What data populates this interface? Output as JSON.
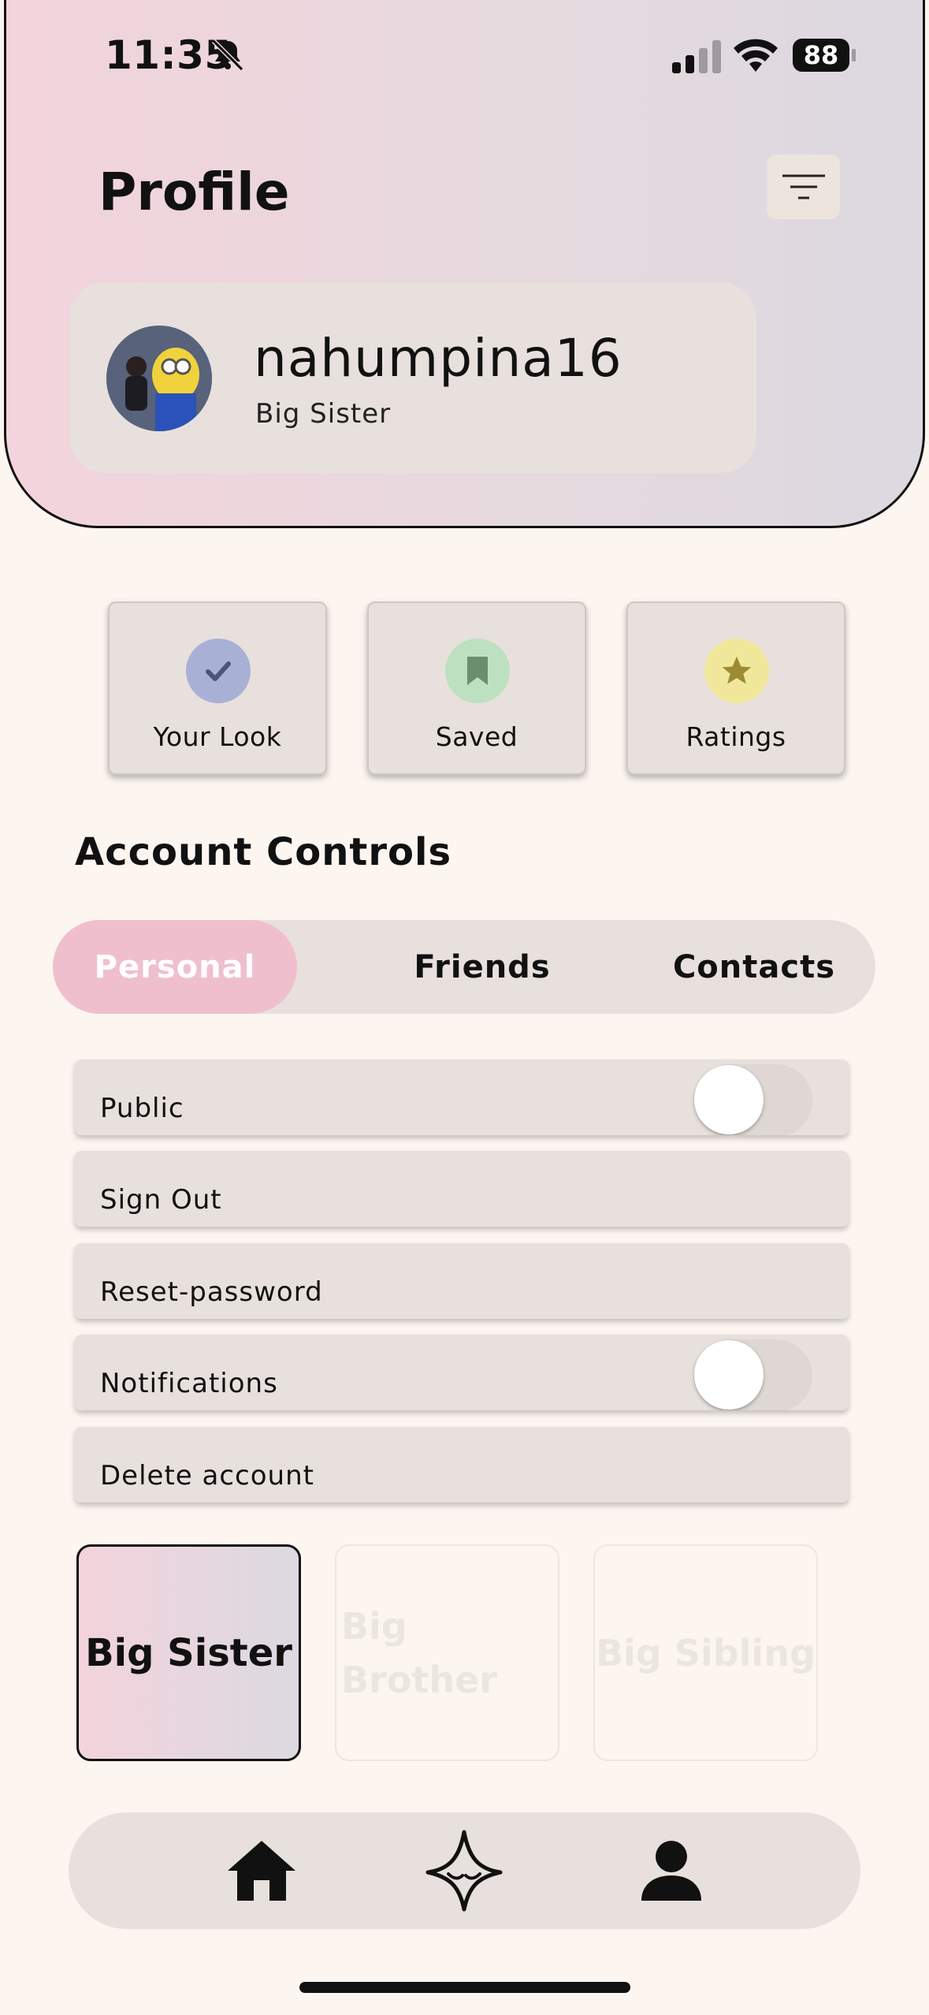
{
  "status_bar": {
    "time": "11:35",
    "battery": "88"
  },
  "header": {
    "title": "Profile"
  },
  "user": {
    "username": "nahumpina16",
    "role": "Big Sister"
  },
  "tiles": [
    {
      "label": "Your Look",
      "icon": "check-icon",
      "color": "#a9b0d6"
    },
    {
      "label": "Saved",
      "icon": "bookmark-icon",
      "color": "#bde0c0"
    },
    {
      "label": "Ratings",
      "icon": "star-icon",
      "color": "#f1e79a"
    }
  ],
  "account": {
    "title": "Account Controls",
    "tabs": [
      {
        "label": "Personal",
        "active": true
      },
      {
        "label": "Friends",
        "active": false
      },
      {
        "label": "Contacts",
        "active": false
      }
    ],
    "rows": [
      {
        "label": "Public",
        "toggle": false
      },
      {
        "label": "Sign Out"
      },
      {
        "label": "Reset-password"
      },
      {
        "label": "Notifications",
        "toggle": false
      },
      {
        "label": "Delete account"
      }
    ]
  },
  "roles": [
    {
      "label": "Big Sister",
      "selected": true
    },
    {
      "label": "Big Brother",
      "selected": false
    },
    {
      "label": "Big Sibling",
      "selected": false
    }
  ],
  "nav": [
    "home-icon",
    "sparkle-logo-icon",
    "person-icon"
  ],
  "colors": {
    "accent_pink": "#f0bfcd",
    "background": "#fcf5f0",
    "card": "#e8e0dc"
  }
}
